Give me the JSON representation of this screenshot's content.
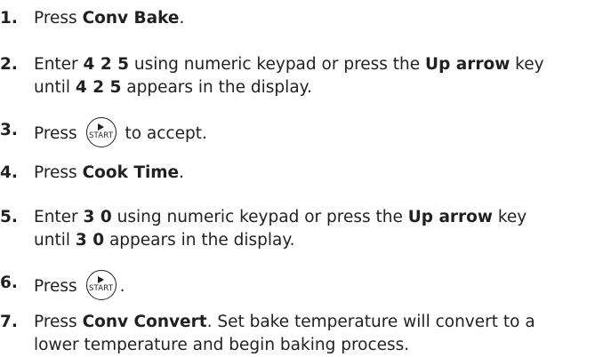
{
  "steps": [
    {
      "num": "1.",
      "a": "Press ",
      "b": "Conv Bake",
      "c": "."
    },
    {
      "num": "2.",
      "a": "Enter ",
      "b": "4 2 5",
      "c": " using numeric keypad or press the ",
      "d": "Up arrow",
      "e": " key",
      "line2a": "until ",
      "line2b": "4 2 5",
      "line2c": " appears in the display."
    },
    {
      "num": "3.",
      "a": "Press ",
      "button": "START",
      "c": " to accept."
    },
    {
      "num": "4.",
      "a": "Press ",
      "b": "Cook Time",
      "c": "."
    },
    {
      "num": "5.",
      "a": "Enter ",
      "b": "3 0",
      "c": " using numeric keypad or press the ",
      "d": "Up arrow",
      "e": " key",
      "line2a": "until ",
      "line2b": "3 0",
      "line2c": " appears in the display."
    },
    {
      "num": "6.",
      "a": "Press ",
      "button": "START",
      "c": "."
    },
    {
      "num": "7.",
      "a": "Press ",
      "b": "Conv Convert",
      "c": ". Set bake temperature will convert to a",
      "line2": "lower temperature and begin baking process."
    }
  ]
}
